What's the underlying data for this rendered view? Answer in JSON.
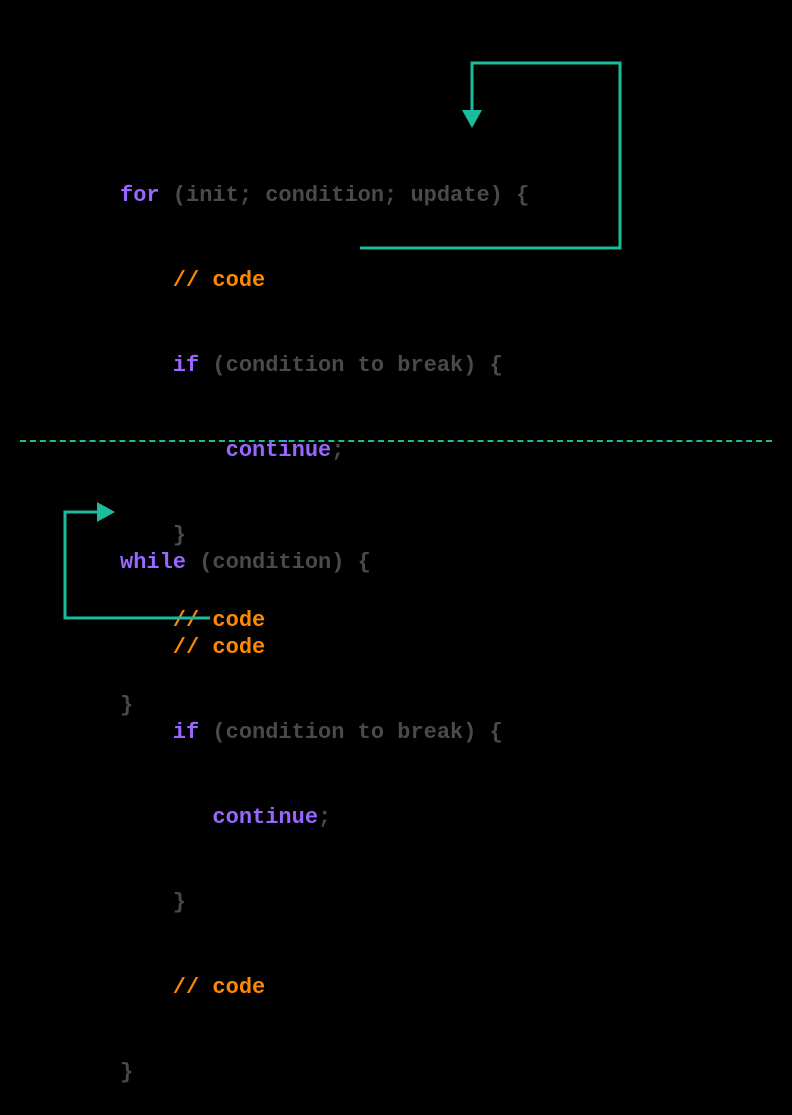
{
  "colors": {
    "background": "#000000",
    "keyword_purple": "#9966ff",
    "keyword_orange": "#ff8800",
    "plain_text": "#4a4a4a",
    "arrow": "#1abc9c",
    "divider": "#1abc9c"
  },
  "top_block": {
    "l1_for": "for",
    "l1_rest": " (init; condition; update) {",
    "l2_slash": "    // ",
    "l2_code": "code",
    "l3_if": "    if ",
    "l3_rest": "(condition to break) {",
    "l4_indent": "        ",
    "l4_continue": "continue",
    "l4_semi": ";",
    "l5": "    }",
    "l6_slash": "    // ",
    "l6_code": "code",
    "l7": "}"
  },
  "bottom_block": {
    "l1_while": "while",
    "l1_rest": " (condition) {",
    "l2_slash": "    // ",
    "l2_code": "code",
    "l3_if": "    if ",
    "l3_rest": "(condition to break) {",
    "l4_indent": "       ",
    "l4_continue": "continue",
    "l4_semi": ";",
    "l5": "    }",
    "l6_slash": "    // ",
    "l6_code": "code",
    "l7": "}"
  }
}
